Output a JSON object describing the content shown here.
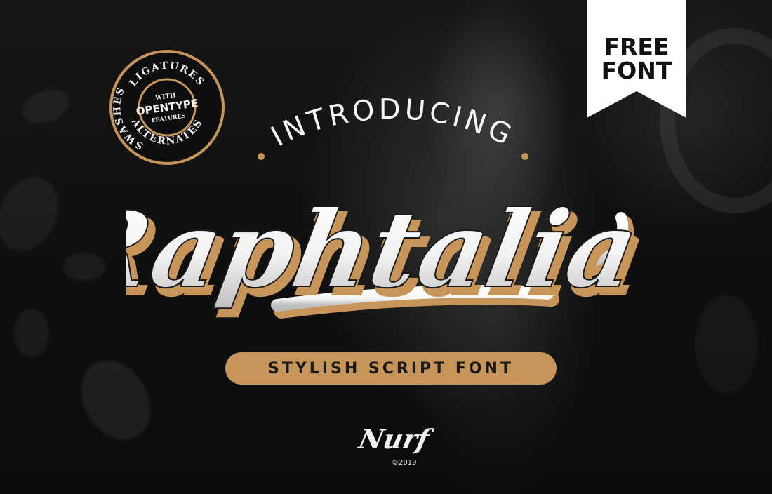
{
  "badge": {
    "ring_top": "LIGATURES",
    "ring_left": "SWASHES",
    "ring_bottom": "ALTERNATES",
    "center_with": "WITH",
    "center_main": "OPENTYPE",
    "center_features": "FEATURES"
  },
  "ribbon": {
    "line1": "FREE",
    "line2": "FONT"
  },
  "heading": {
    "introducing": "INTRODUCING",
    "font_name": "Raphtalia",
    "tagline": "STYLISH SCRIPT FONT"
  },
  "signature": {
    "name": "Nurf",
    "copyright": "©2019"
  },
  "colors": {
    "accent_gold": "#c7955a",
    "background": "#0d0d0d",
    "white": "#ffffff"
  }
}
